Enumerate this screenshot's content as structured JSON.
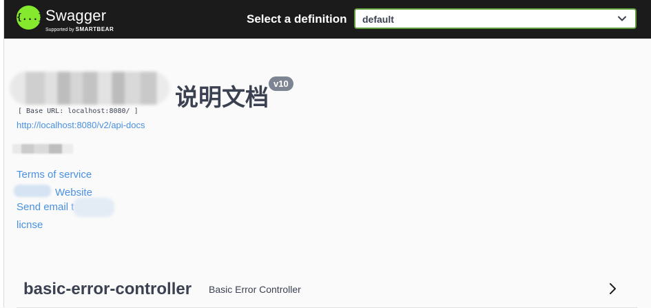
{
  "topbar": {
    "logo_glyph": "{...}",
    "brand_name": "Swagger",
    "brand_sub_prefix": "Supported by",
    "brand_sub_company": "SMARTBEAR",
    "select_label": "Select a definition",
    "select_value": "default",
    "icons": {
      "logo": "swagger-logo",
      "dropdown": "chevron-down-icon"
    },
    "colors": {
      "bar_bg": "#1b1b1b",
      "logo_green": "#85ea2d",
      "select_border": "#62a03f"
    }
  },
  "info": {
    "title_visible": "说明文档",
    "version": "v10",
    "base_url": "[ Base URL: localhost:8080/ ]",
    "api_docs_url": "http://localhost:8080/v2/api-docs",
    "links": {
      "terms": "Terms of service",
      "website": "Website",
      "email": "Send email t",
      "license": "licnse"
    },
    "colors": {
      "link": "#4990e2",
      "badge_bg": "#7d8492"
    }
  },
  "tags": [
    {
      "name": "basic-error-controller",
      "description": "Basic Error Controller",
      "icon": "chevron-right-icon"
    }
  ]
}
